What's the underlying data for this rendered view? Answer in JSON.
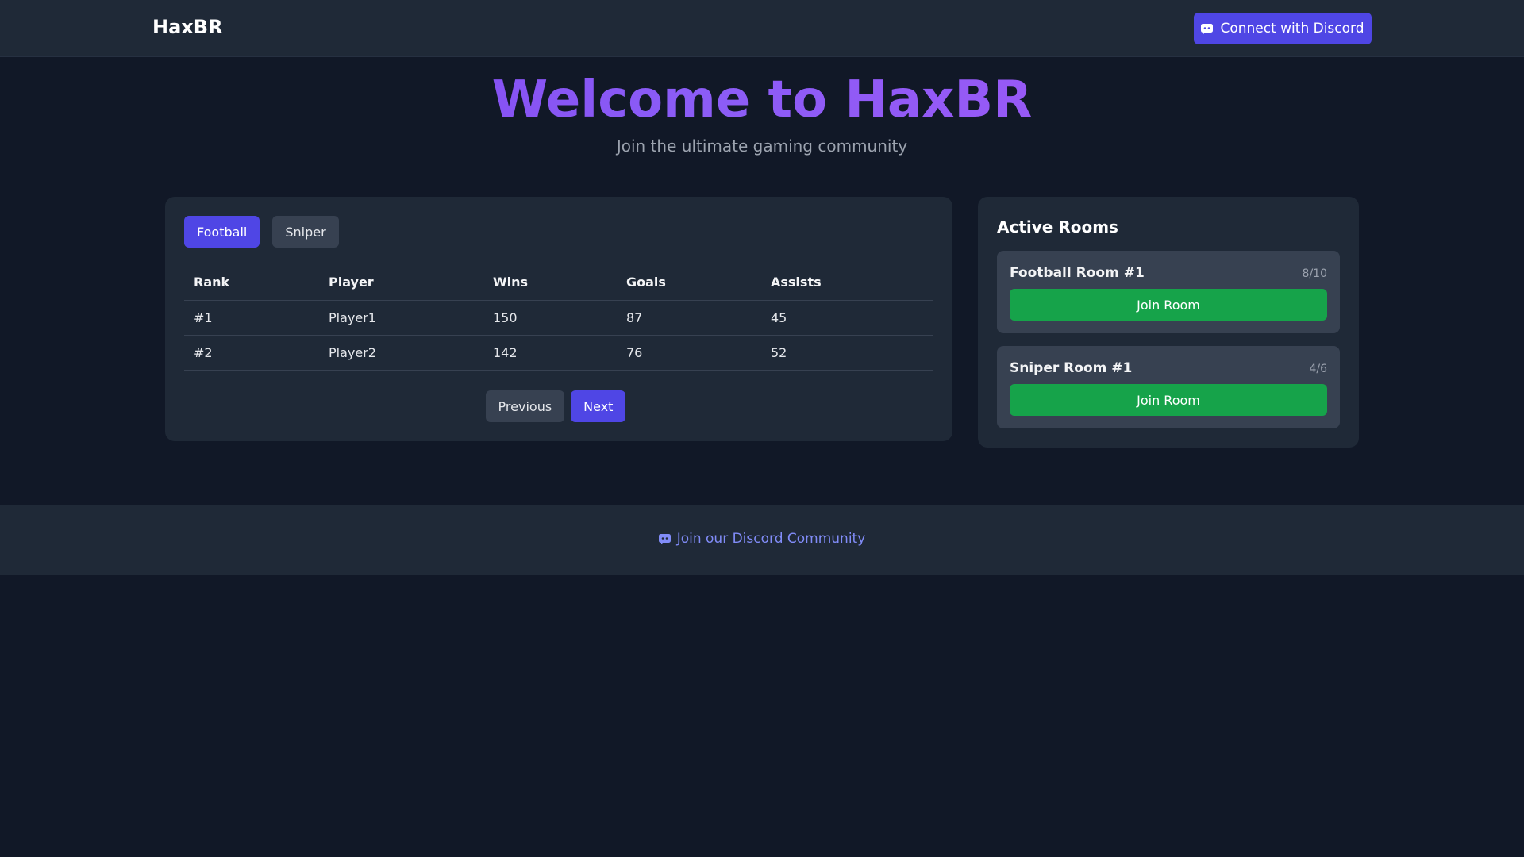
{
  "navbar": {
    "brand": "HaxBR",
    "connect_button": "Connect with Discord"
  },
  "hero": {
    "title": "Welcome to HaxBR",
    "subtitle": "Join the ultimate gaming community"
  },
  "leaderboard": {
    "tabs": [
      {
        "label": "Football",
        "active": true
      },
      {
        "label": "Sniper",
        "active": false
      }
    ],
    "columns": [
      "Rank",
      "Player",
      "Wins",
      "Goals",
      "Assists"
    ],
    "rows": [
      {
        "rank": "#1",
        "player": "Player1",
        "wins": "150",
        "goals": "87",
        "assists": "45"
      },
      {
        "rank": "#2",
        "player": "Player2",
        "wins": "142",
        "goals": "76",
        "assists": "52"
      }
    ],
    "pager": {
      "previous": "Previous",
      "next": "Next"
    }
  },
  "rooms": {
    "title": "Active Rooms",
    "items": [
      {
        "name": "Football Room #1",
        "count": "8/10",
        "join_label": "Join Room"
      },
      {
        "name": "Sniper Room #1",
        "count": "4/6",
        "join_label": "Join Room"
      }
    ]
  },
  "footer": {
    "link": "Join our Discord Community"
  },
  "colors": {
    "background": "#111827",
    "surface": "#1f2937",
    "accent": "#4f46e5",
    "title_gradient": "#8b5cf6",
    "join_green": "#16a34a",
    "link": "#818cf8"
  },
  "icons": {
    "connect_button_icon": "discord-icon",
    "footer_link_icon": "discord-icon"
  }
}
